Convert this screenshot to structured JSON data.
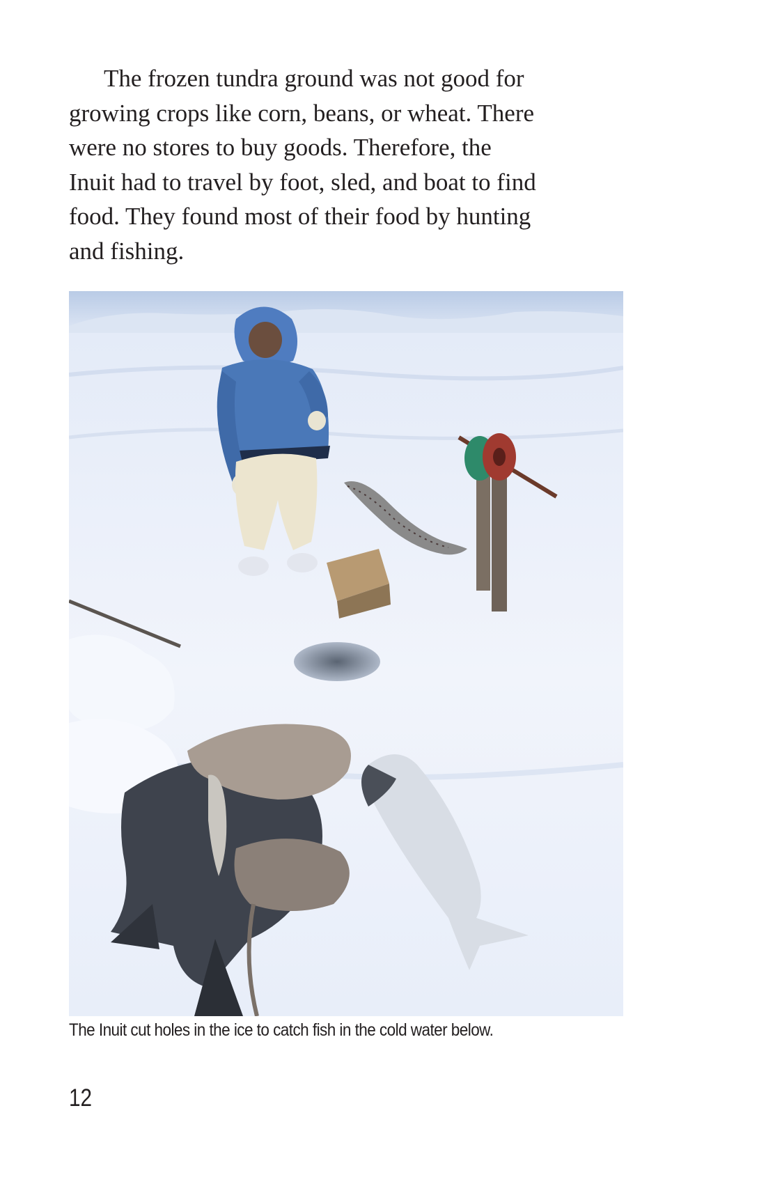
{
  "body": {
    "lines": [
      "The frozen tundra ground was not good for",
      "growing crops like corn, beans, or wheat. There",
      "were no stores to buy goods. Therefore, the",
      "Inuit had to travel by foot, sled, and boat to find",
      "food. They found most of their food by hunting",
      "and fishing."
    ]
  },
  "photo": {
    "caption": "The Inuit cut holes in the ice to catch fish in the cold water below."
  },
  "page_number": "12",
  "colors": {
    "text": "#231f20",
    "sky": "#c9d8ee",
    "snow": "#eef2fb",
    "parka": "#4a78b8"
  }
}
